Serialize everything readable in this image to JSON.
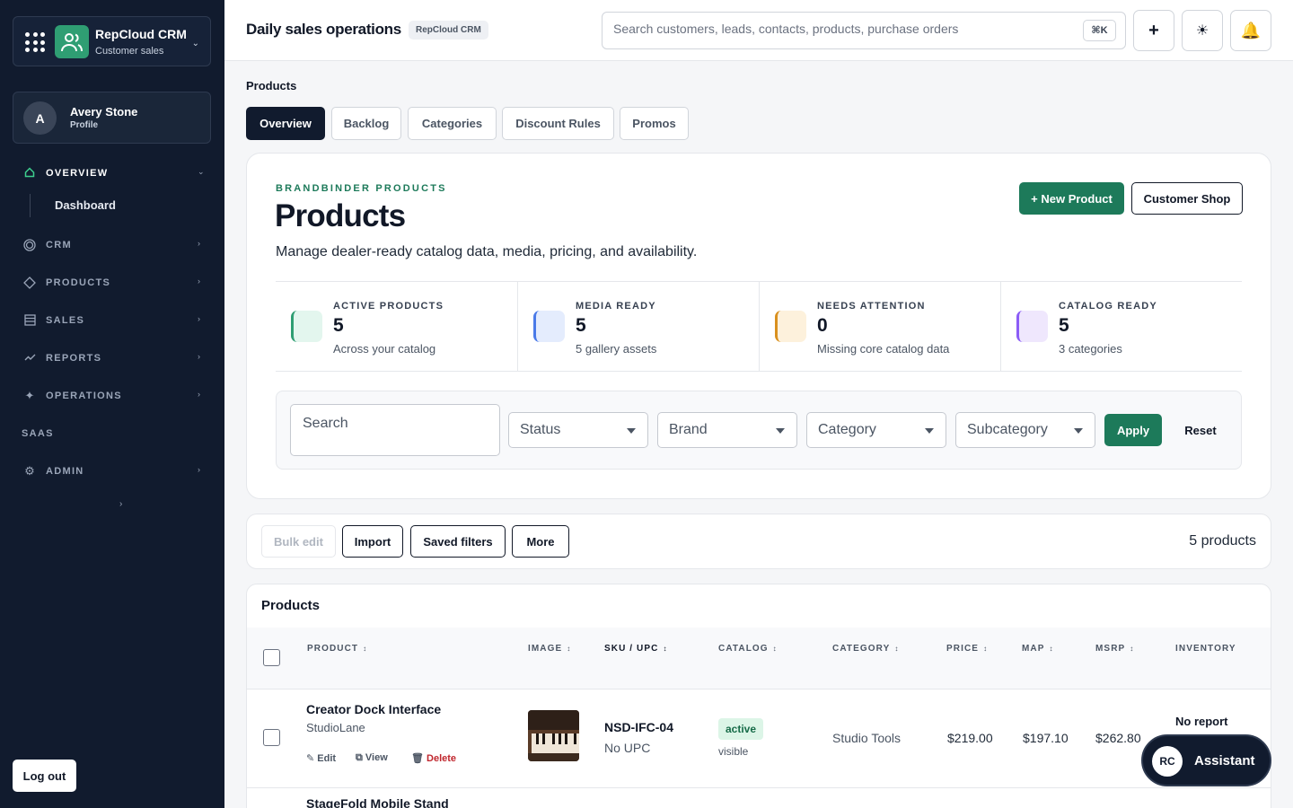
{
  "app": {
    "name": "RepCloud CRM",
    "subtitle": "Customer sales"
  },
  "profile": {
    "initial": "A",
    "name": "Avery Stone",
    "label": "Profile"
  },
  "sidebar": {
    "items": [
      {
        "label": "OVERVIEW",
        "icon": "home-icon"
      },
      {
        "label": "CRM",
        "icon": "circle-icon"
      },
      {
        "label": "PRODUCTS",
        "icon": "tag-icon"
      },
      {
        "label": "SALES",
        "icon": "table-icon"
      },
      {
        "label": "REPORTS",
        "icon": "chart-icon"
      },
      {
        "label": "OPERATIONS",
        "icon": "sparkle-icon"
      },
      {
        "label": "ADMIN",
        "icon": "gear-icon"
      }
    ],
    "sub_item": "Dashboard",
    "section_label": "SAAS",
    "logout": "Log out"
  },
  "header": {
    "title": "Daily sales operations",
    "badge": "RepCloud CRM",
    "search_placeholder": "Search customers, leads, contacts, products, purchase orders",
    "shortcut": "⌘K"
  },
  "breadcrumb": "Products",
  "tabs": [
    "Overview",
    "Backlog",
    "Categories",
    "Discount Rules",
    "Promos"
  ],
  "hero": {
    "eyebrow": "BRANDBINDER PRODUCTS",
    "title": "Products",
    "description": "Manage dealer-ready catalog data, media, pricing, and availability.",
    "new_button": "+ New Product",
    "shop_button": "Customer Shop"
  },
  "stats": [
    {
      "label": "ACTIVE PRODUCTS",
      "value": "5",
      "sub": "Across your catalog",
      "color": "#2f9e73",
      "bg": "#e3f6ee"
    },
    {
      "label": "MEDIA READY",
      "value": "5",
      "sub": "5 gallery assets",
      "color": "#4a7ae8",
      "bg": "#e4ecfd"
    },
    {
      "label": "NEEDS ATTENTION",
      "value": "0",
      "sub": "Missing core catalog data",
      "color": "#d9901e",
      "bg": "#fdf1dc"
    },
    {
      "label": "CATALOG READY",
      "value": "5",
      "sub": "3 categories",
      "color": "#8b5cf6",
      "bg": "#efe7fd"
    }
  ],
  "filters": {
    "search_placeholder": "Search",
    "selects": [
      "Status",
      "Brand",
      "Category",
      "Subcategory"
    ],
    "apply": "Apply",
    "reset": "Reset"
  },
  "actions": {
    "bulk_edit": "Bulk edit",
    "import": "Import",
    "saved_filters": "Saved filters",
    "more": "More",
    "count": "5 products"
  },
  "table": {
    "title": "Products",
    "columns": [
      "PRODUCT",
      "IMAGE",
      "SKU / UPC",
      "CATALOG",
      "CATEGORY",
      "PRICE",
      "MAP",
      "MSRP",
      "INVENTORY"
    ],
    "rows": [
      {
        "name": "Creator Dock Interface",
        "brand": "StudioLane",
        "edit": "Edit",
        "view": "View",
        "delete": "Delete",
        "sku": "NSD-IFC-04",
        "upc": "No UPC",
        "status": "active",
        "visibility": "visible",
        "category": "Studio Tools",
        "price": "$219.00",
        "map": "$197.10",
        "msrp": "$262.80",
        "inventory": "No report"
      },
      {
        "name": "StageFold Mobile Stand"
      }
    ]
  },
  "assistant": {
    "initials": "RC",
    "label": "Assistant"
  }
}
